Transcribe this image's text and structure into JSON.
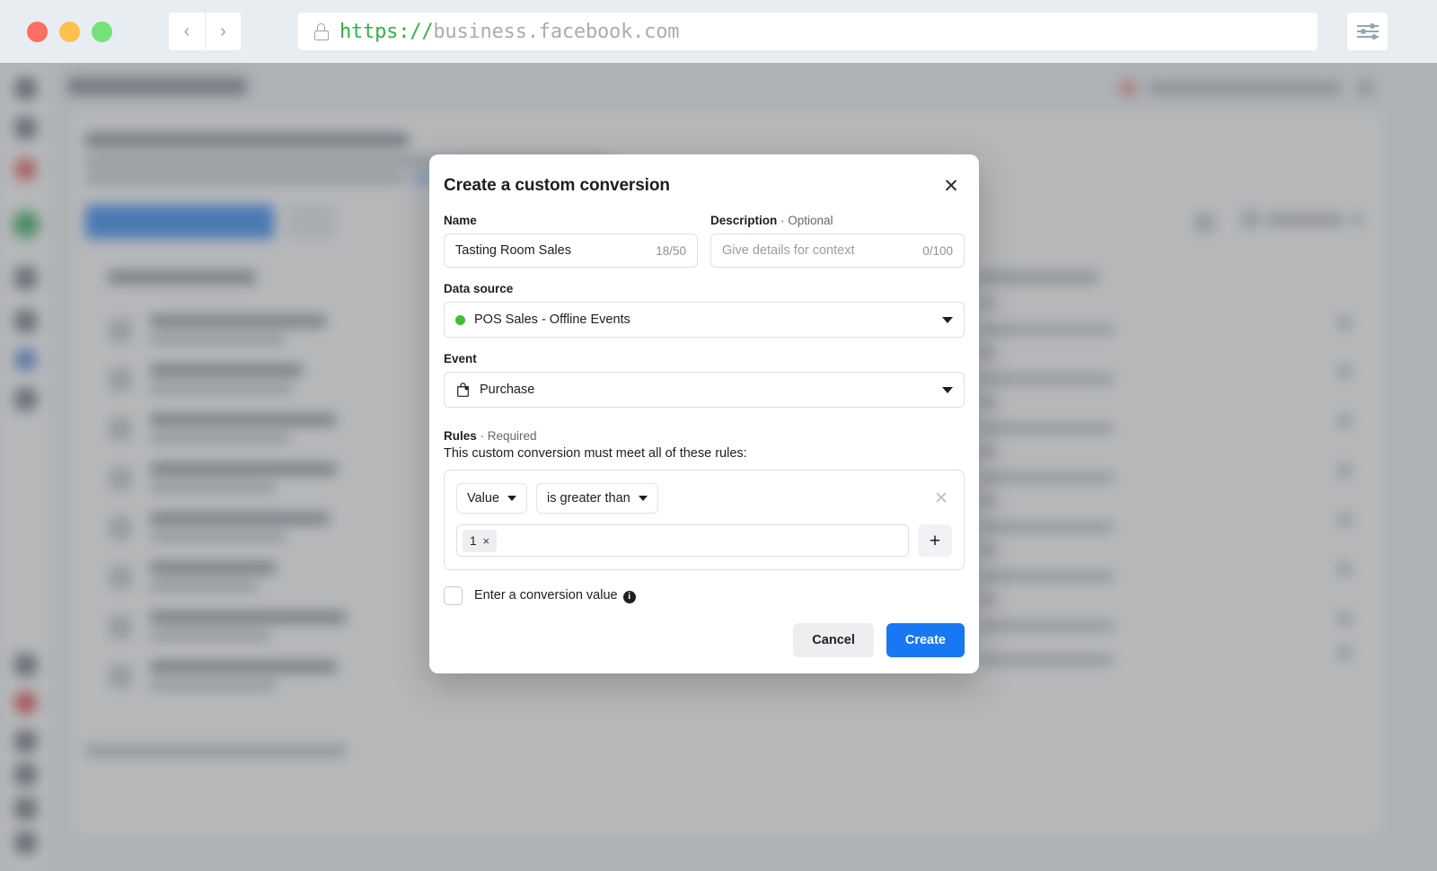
{
  "browser": {
    "url_scheme": "https://",
    "url_host": "business.facebook.com",
    "back_label": "‹",
    "forward_label": "›"
  },
  "modal": {
    "title": "Create a custom conversion",
    "name": {
      "label": "Name",
      "value": "Tasting Room Sales",
      "counter": "18/50"
    },
    "description": {
      "label": "Description",
      "optional_suffix": " · Optional",
      "placeholder": "Give details for context",
      "counter": "0/100"
    },
    "data_source": {
      "label": "Data source",
      "value": "POS Sales - Offline Events",
      "status_color": "#3fbf33"
    },
    "event": {
      "label": "Event",
      "value": "Purchase"
    },
    "rules": {
      "label": "Rules",
      "required_suffix": " · Required",
      "description": "This custom conversion must meet all of these rules:",
      "row": {
        "parameter": "Value",
        "operator": "is greater than",
        "token_value": "1",
        "token_remove": "×",
        "remove_label": "✕",
        "add_label": "+"
      }
    },
    "conversion_value": {
      "label": "Enter a conversion value",
      "checked": false,
      "info_label": "i"
    },
    "footer": {
      "cancel": "Cancel",
      "create": "Create"
    },
    "close_label": "✕"
  },
  "colors": {
    "primary": "#1877f2",
    "status_green": "#3fbf33"
  }
}
